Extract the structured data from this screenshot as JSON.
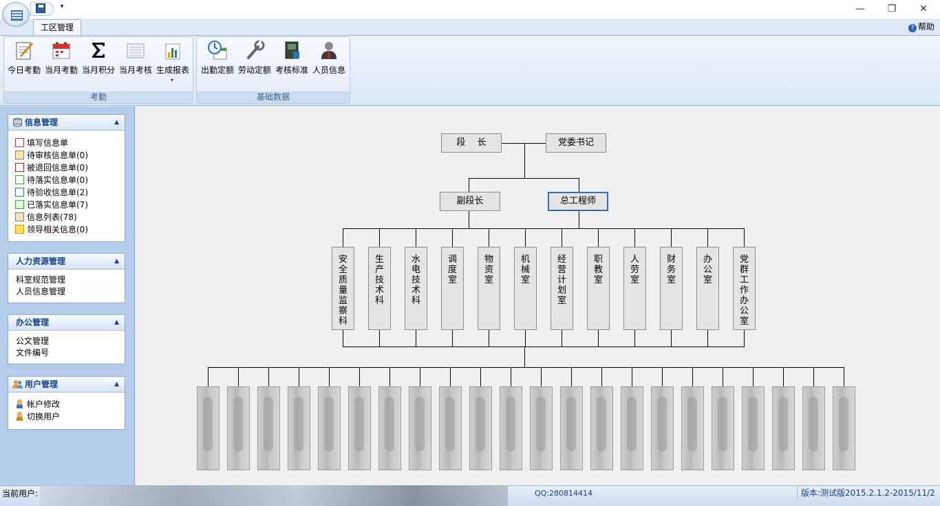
{
  "ribbon": {
    "tab": "工区管理",
    "help": "帮助",
    "group_kaoqin": "考勤",
    "group_jichu": "基础数据",
    "buttons": [
      "今日考勤",
      "当月考勤",
      "当月积分",
      "当月考核",
      "生成报表",
      "出勤定额",
      "劳动定额",
      "考核标准",
      "人员信息"
    ]
  },
  "sidebar": {
    "info": {
      "title": "信息管理",
      "items": [
        "填写信息单",
        "待审核信息单(0)",
        "被退回信息单(0)",
        "待落实信息单(0)",
        "待验收信息单(2)",
        "已落实信息单(7)",
        "信息列表(78)",
        "领导相关信息(0)"
      ]
    },
    "hr": {
      "title": "人力资源管理",
      "items": [
        "科室规范管理",
        "人员信息管理"
      ]
    },
    "office": {
      "title": "办公管理",
      "items": [
        "公文管理",
        "文件编号"
      ]
    },
    "user": {
      "title": "用户管理",
      "items": [
        "帐户修改",
        "切换用户"
      ]
    }
  },
  "org": {
    "chief": "段　 长",
    "party": "党委书记",
    "deputy": "副段长",
    "engineer": "总工程师",
    "depts": [
      "安全质量监察科",
      "生产技术科",
      "水电技术科",
      "调度室",
      "物资室",
      "机械室",
      "经营计划室",
      "职教室",
      "人劳室",
      "财务室",
      "办公室",
      "党群工作办公室"
    ]
  },
  "status": {
    "user_label": "当前用户:",
    "qq": "QQ:280814414",
    "version": "版本:测试版2015.2.1.2-2015/11/2"
  },
  "colors": {
    "accent": "#15428b",
    "selected_border": "#2f6db5"
  }
}
